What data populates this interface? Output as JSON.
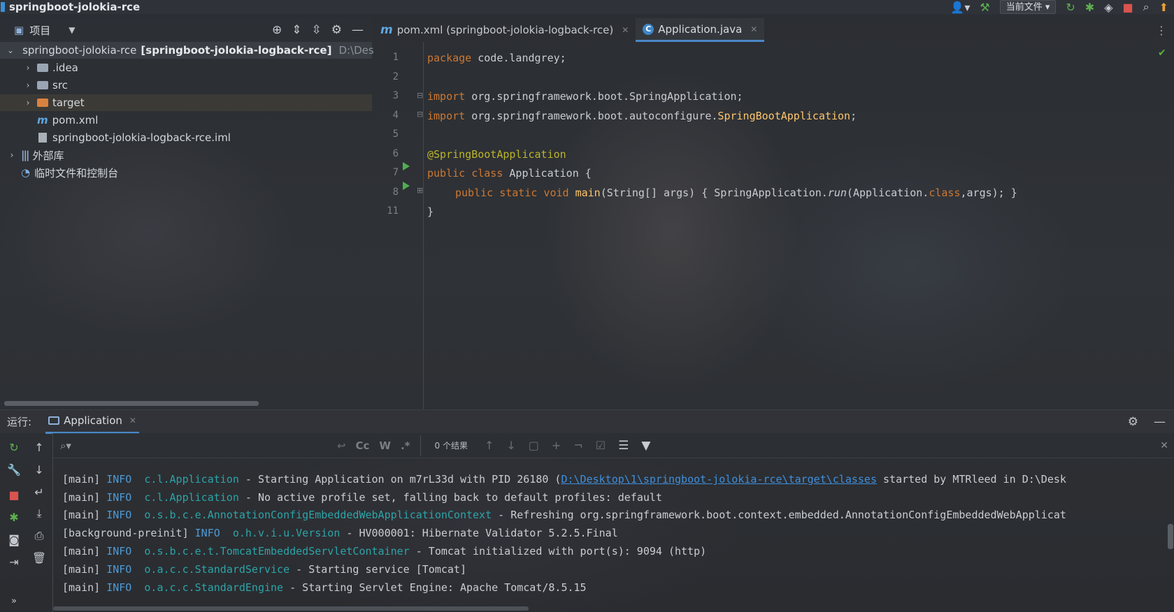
{
  "titlebar": {
    "title": "springboot-jolokia-rce",
    "run_config": "当前文件 ▾",
    "icons": [
      "user-icon",
      "build-hammer-icon",
      "rerun-icon",
      "debug-icon",
      "coverage-icon",
      "stop-icon",
      "search-icon",
      "update-icon"
    ]
  },
  "project_panel": {
    "title": "项目",
    "tree": [
      {
        "label": "springboot-jolokia-rce",
        "module": "[springboot-jolokia-logback-rce]",
        "path": "D:\\Des",
        "expanded": true
      },
      {
        "label": ".idea"
      },
      {
        "label": "src"
      },
      {
        "label": "target"
      },
      {
        "label": "pom.xml"
      },
      {
        "label": "springboot-jolokia-logback-rce.iml"
      },
      {
        "label": "外部库"
      },
      {
        "label": "临时文件和控制台"
      }
    ]
  },
  "editor": {
    "tabs": [
      {
        "label": "pom.xml (springboot-jolokia-logback-rce)",
        "icon": "maven-icon",
        "active": false
      },
      {
        "label": "Application.java",
        "icon": "class-icon",
        "active": true
      }
    ],
    "line_numbers": [
      "1",
      "2",
      "3",
      "4",
      "5",
      "6",
      "7",
      "8",
      "11"
    ],
    "code": {
      "l1_kw": "package",
      "l1_rest": " code.landgrey;",
      "l3_kw": "import",
      "l3_rest": " org.springframework.boot.SpringApplication;",
      "l4_kw": "import",
      "l4_mid": " org.springframework.boot.autoconfigure.",
      "l4_cls": "SpringBootApplication",
      "l4_end": ";",
      "l6_ann": "@SpringBootApplication",
      "l7_kw": "public class",
      "l7_rest": " Application {",
      "l8_kw": "public static void",
      "l8_fn": "main",
      "l8_a": "(String[] args) { SpringApplication.",
      "l8_run": "run",
      "l8_b": "(Application.",
      "l8_kw2": "class",
      "l8_c": ",args); }",
      "l11": "}"
    }
  },
  "run_panel": {
    "label": "运行:",
    "tab": "Application",
    "search": {
      "placeholder": "",
      "results": "0 个结果",
      "options": [
        "Cc",
        "W",
        ".*"
      ]
    },
    "logs": [
      {
        "thread": "[main] ",
        "level": "INFO",
        "logger": "c.l.Application",
        "msg": " - Starting Application on m7rL33d with PID 26180 (",
        "link": "D:\\Desktop\\1\\springboot-jolokia-rce\\target\\classes",
        "tail": " started by MTRleed in D:\\Desk"
      },
      {
        "thread": "[main] ",
        "level": "INFO",
        "logger": "c.l.Application",
        "msg": " - No active profile set, falling back to default profiles: default"
      },
      {
        "thread": "[main] ",
        "level": "INFO",
        "logger": "o.s.b.c.e.AnnotationConfigEmbeddedWebApplicationContext",
        "msg": " - Refreshing org.springframework.boot.context.embedded.AnnotationConfigEmbeddedWebApplicat"
      },
      {
        "thread": "[background-preinit] ",
        "level": "INFO",
        "logger": "o.h.v.i.u.Version",
        "msg": " - HV000001: Hibernate Validator 5.2.5.Final"
      },
      {
        "thread": "[main] ",
        "level": "INFO",
        "logger": "o.s.b.c.e.t.TomcatEmbeddedServletContainer",
        "msg": " - Tomcat initialized with port(s): 9094 (http)"
      },
      {
        "thread": "[main] ",
        "level": "INFO",
        "logger": "o.a.c.c.StandardService",
        "msg": " - Starting service [Tomcat]"
      },
      {
        "thread": "[main] ",
        "level": "INFO",
        "logger": "o.a.c.c.StandardEngine",
        "msg": " - Starting Servlet Engine: Apache Tomcat/8.5.15"
      }
    ]
  }
}
